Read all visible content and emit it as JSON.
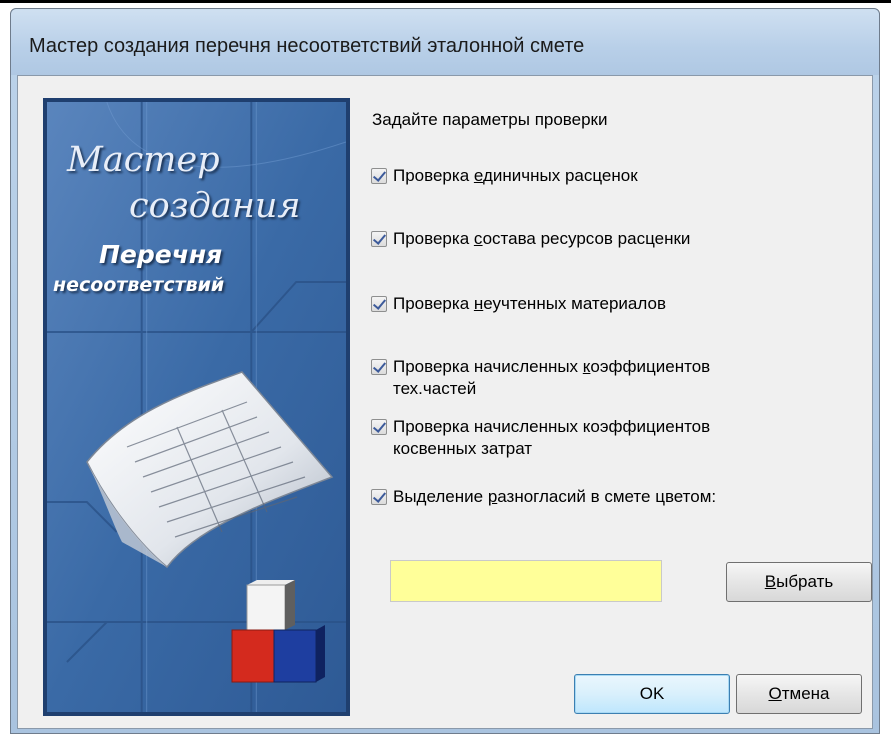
{
  "window": {
    "title": "Мастер создания перечня несоответствий эталонной смете"
  },
  "banner": {
    "line1": "Мастер",
    "line2": "создания",
    "line3": "Перечня",
    "line4": "несоответствий"
  },
  "params": {
    "heading": "Задайте параметры проверки",
    "checks": [
      {
        "pre": "Проверка ",
        "accel": "е",
        "post": "диничных расценок",
        "checked": true
      },
      {
        "pre": "Проверка ",
        "accel": "с",
        "post": "остава ресурсов расценки",
        "checked": true
      },
      {
        "pre": "Проверка ",
        "accel": "н",
        "post": "еучтенных материалов",
        "checked": true
      },
      {
        "pre": "Проверка начисленных ",
        "accel": "к",
        "post": "оэффициентов",
        "line2": "тех.частей",
        "checked": true
      },
      {
        "pre": "Проверка начисленных коэффициентов",
        "accel": "",
        "post": "",
        "line2": "косвенных затрат",
        "checked": true
      },
      {
        "pre": "Выделение ",
        "accel": "р",
        "post": "азногласий в смете цветом:",
        "checked": true
      }
    ]
  },
  "color": {
    "value": "#ffff99"
  },
  "buttons": {
    "choose_accel": "В",
    "choose_rest": "ыбрать",
    "ok": "OK",
    "cancel_accel": "О",
    "cancel_rest": "тмена"
  }
}
